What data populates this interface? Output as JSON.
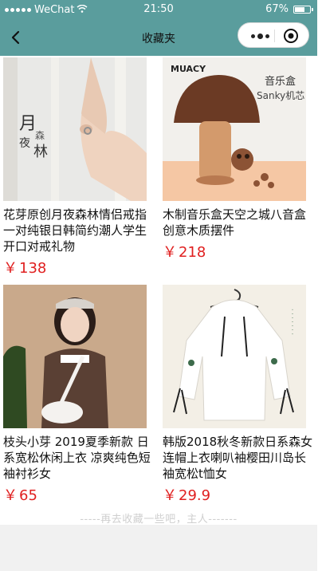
{
  "status_bar": {
    "carrier": "WeChat",
    "time": "21:50",
    "battery": "67%",
    "battery_level": 0.67
  },
  "nav": {
    "title": "收藏夹"
  },
  "products": [
    {
      "name": "花芽原创月夜森林情侣戒指一对纯银日韩简约潮人学生开口对戒礼物",
      "currency": "￥",
      "price": "138",
      "image": "ring-hand-photo"
    },
    {
      "name": "木制音乐盒天空之城八音盒创意木质摆件",
      "currency": "￥",
      "price": "218",
      "image": "mushroom-music-box-photo",
      "image_text": {
        "brand": "MUACY",
        "label": "音乐盒",
        "sub": "Sanky机芯"
      }
    },
    {
      "name": "枝头小芽 2019夏季新款 日系宽松休闲上衣 凉爽纯色短袖衬衫女",
      "currency": "￥",
      "price": "65",
      "image": "girl-brown-shirt-photo"
    },
    {
      "name": "韩版2018秋冬新款日系森女连帽上衣喇叭袖樱田川岛长袖宽松t恤女",
      "currency": "￥",
      "price": "29.9",
      "image": "white-hoodie-photo"
    }
  ],
  "footer_tip": "-----再去收藏一些吧，主人-------",
  "colors": {
    "nav_bg": "#5a9d9d",
    "price": "#e02020"
  }
}
